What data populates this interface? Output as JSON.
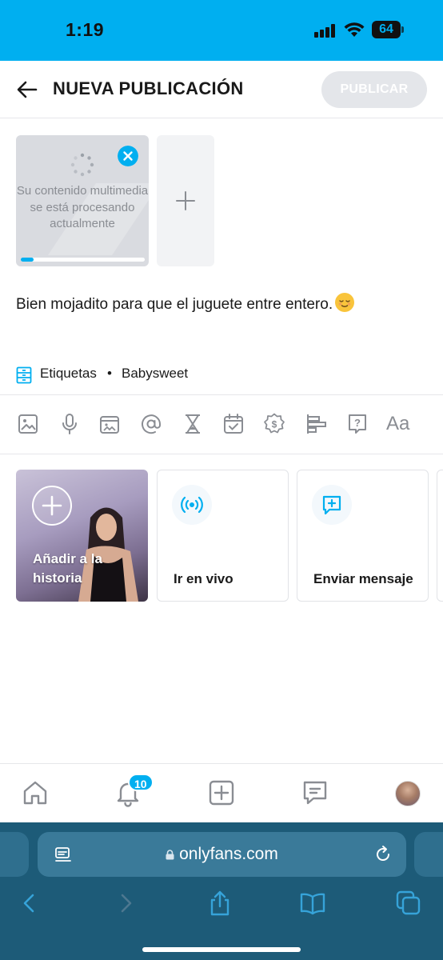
{
  "status_bar": {
    "time": "1:19",
    "battery": "64"
  },
  "header": {
    "title": "NUEVA PUBLICACIÓN",
    "publish_label": "PUBLICAR",
    "back_icon": "arrow-left-icon"
  },
  "media": {
    "processing_text": "Su contenido multimedia se está procesando actualmente",
    "progress": 0.1,
    "remove_icon": "close-icon",
    "add_icon": "plus-icon"
  },
  "caption": {
    "text": "Bien mojadito para que el juguete entre entero.",
    "emoji": "relieved-face-emoji"
  },
  "tags": {
    "label": "Etiquetas",
    "separator": "•",
    "value": "Babysweet"
  },
  "toolbar": {
    "tools": [
      "image-icon",
      "microphone-icon",
      "vault-icon",
      "mention-icon",
      "hourglass-icon",
      "calendar-check-icon",
      "price-icon",
      "poll-icon",
      "quiz-icon",
      "text-format-icon"
    ],
    "text_format_label": "Aa"
  },
  "actions": {
    "story_label": "Añadir a la historia",
    "live_label": "Ir en vivo",
    "message_label": "Enviar mensaje"
  },
  "tab_bar": {
    "notification_count": "10"
  },
  "browser": {
    "url": "onlyfans.com"
  },
  "colors": {
    "accent": "#00AFF0",
    "safari_bg": "#1d5b78"
  }
}
